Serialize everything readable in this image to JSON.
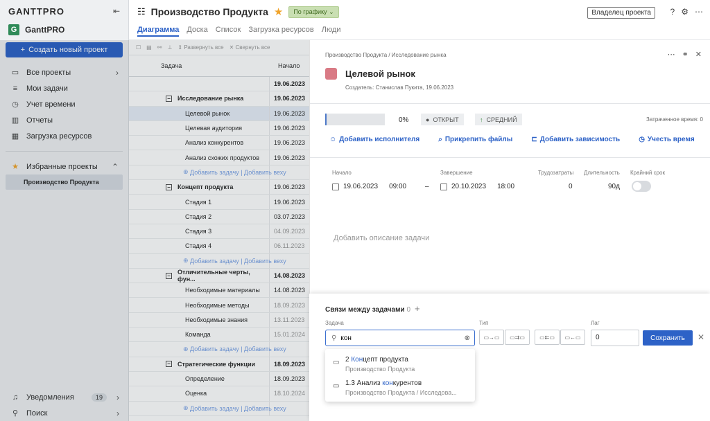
{
  "sidebar": {
    "logo": "GANTTPRO",
    "workspace": "GanttPRO",
    "workspace_letter": "G",
    "create_label": "Создать новый проект",
    "nav": [
      {
        "label": "Все проекты",
        "icon": "folder-icon"
      },
      {
        "label": "Мои задачи",
        "icon": "list-icon"
      },
      {
        "label": "Учет времени",
        "icon": "clock-icon"
      },
      {
        "label": "Отчеты",
        "icon": "chart-icon"
      },
      {
        "label": "Загрузка ресурсов",
        "icon": "grid-icon"
      }
    ],
    "favorites_label": "Избранные проекты",
    "favorite_project": "Производство Продукта",
    "notifications_label": "Уведомления",
    "notifications_count": "19",
    "search_label": "Поиск"
  },
  "header": {
    "project_title": "Производство Продукта",
    "status": "По графику",
    "owner_label": "Владелец проекта",
    "tabs": [
      "Диаграмма",
      "Доска",
      "Список",
      "Загрузка ресурсов",
      "Люди"
    ]
  },
  "toolbar": {
    "expand_all": "Развернуть все",
    "collapse_all": "Свернуть все"
  },
  "grid": {
    "col_task": "Задача",
    "col_start": "Начало",
    "project_start": "19.06.2023",
    "add_label": "Добавить задачу | Добавить веху",
    "rows": [
      {
        "name": "Исследование рынка",
        "date": "19.06.2023",
        "level": 1
      },
      {
        "name": "Целевой рынок",
        "date": "19.06.2023",
        "level": 2
      },
      {
        "name": "Целевая аудитория",
        "date": "19.06.2023",
        "level": 2
      },
      {
        "name": "Анализ конкурентов",
        "date": "19.06.2023",
        "level": 2
      },
      {
        "name": "Анализ схожих продуктов",
        "date": "19.06.2023",
        "level": 2
      },
      {
        "name": "Концепт продукта",
        "date": "19.06.2023",
        "level": 1
      },
      {
        "name": "Стадия 1",
        "date": "19.06.2023",
        "level": 2
      },
      {
        "name": "Стадия 2",
        "date": "03.07.2023",
        "level": 2
      },
      {
        "name": "Стадия 3",
        "date": "04.09.2023",
        "level": 2
      },
      {
        "name": "Стадия 4",
        "date": "06.11.2023",
        "level": 2
      },
      {
        "name": "Отличительные черты, фун...",
        "date": "14.08.2023",
        "level": 1
      },
      {
        "name": "Необходимые материалы",
        "date": "14.08.2023",
        "level": 2
      },
      {
        "name": "Необходимые методы",
        "date": "18.09.2023",
        "level": 2
      },
      {
        "name": "Необходимые знания",
        "date": "13.11.2023",
        "level": 2
      },
      {
        "name": "Команда",
        "date": "15.01.2024",
        "level": 2
      },
      {
        "name": "Стратегические функции",
        "date": "18.09.2023",
        "level": 1
      },
      {
        "name": "Определение",
        "date": "18.09.2023",
        "level": 2
      },
      {
        "name": "Оценка",
        "date": "18.10.2024",
        "level": 2
      }
    ]
  },
  "task": {
    "breadcrumb": "Производство Продукта / Исследование рынка",
    "title": "Целевой рынок",
    "creator": "Создатель: Станислав Пукита, 19.06.2023",
    "progress_pct": "0%",
    "status": "ОТКРЫТ",
    "priority": "СРЕДНИЙ",
    "time_spent": "Затраченное время: 0",
    "actions": [
      "Добавить исполнителя",
      "Прикрепить файлы",
      "Добавить зависимость",
      "Учесть время"
    ],
    "start_label": "Начало",
    "start_date": "19.06.2023",
    "start_time": "09:00",
    "end_label": "Завершение",
    "end_date": "20.10.2023",
    "end_time": "18:00",
    "effort_label": "Трудозатраты",
    "effort": "0",
    "duration_label": "Длительность",
    "duration": "90д",
    "deadline_label": "Крайний срок",
    "description_placeholder": "Добавить описание задачи"
  },
  "links": {
    "title": "Связи между задачами",
    "count": "0",
    "task_label": "Задача",
    "type_label": "Тип",
    "lag_label": "Лаг",
    "search_value": "кон",
    "lag_value": "0",
    "save_label": "Сохранить",
    "results": [
      {
        "pre": "2 ",
        "match": "Кон",
        "post": "цепт продукта",
        "sub": "Производство Продукта",
        "icon": "folder-icon"
      },
      {
        "pre": "1.3 Анализ ",
        "match": "кон",
        "post": "курентов",
        "sub": "Производство Продукта / Исследова...",
        "icon": "task-icon"
      }
    ]
  },
  "colors": {
    "accent": "#2d62c7",
    "task_color": "#d97a85",
    "status_green": "#c9dfb2"
  }
}
